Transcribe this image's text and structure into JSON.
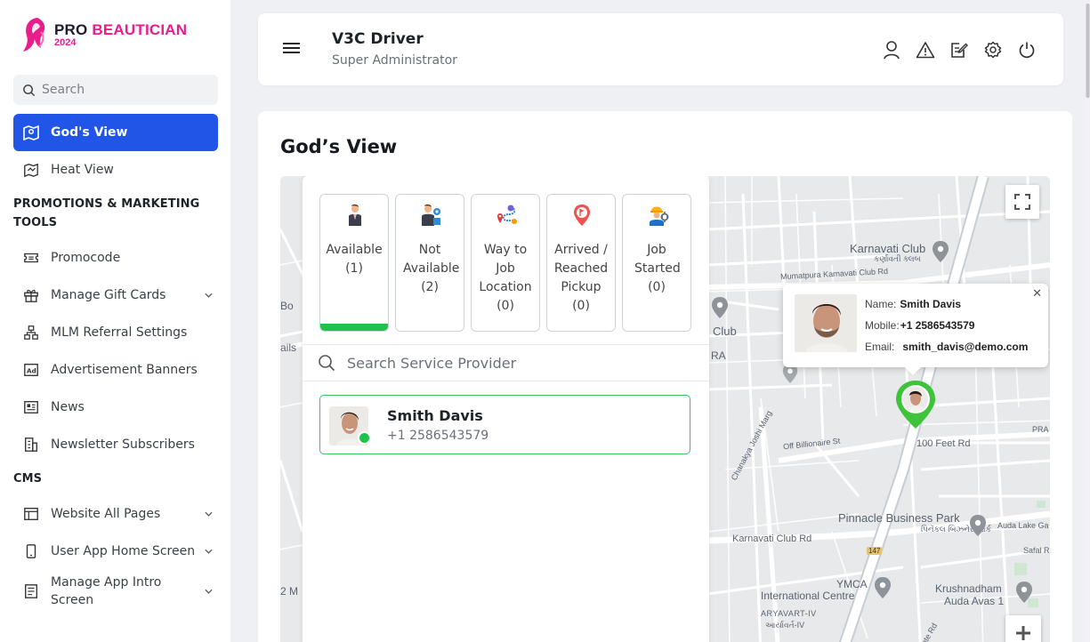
{
  "brand": {
    "name_part1": "PRO",
    "name_part2": "BEAUTICIAN",
    "year": "2024",
    "accent": "#e91e8c"
  },
  "sidebar": {
    "search_placeholder": "Search",
    "items": [
      {
        "label": "God's View",
        "icon": "map-icon",
        "active": true
      },
      {
        "label": "Heat View",
        "icon": "heat-map-icon"
      }
    ],
    "sections": [
      {
        "title": "PROMOTIONS & MARKETING TOOLS",
        "items": [
          {
            "label": "Promocode",
            "icon": "ticket-icon"
          },
          {
            "label": "Manage Gift Cards",
            "icon": "gift-icon",
            "has_submenu": true
          },
          {
            "label": "MLM Referral Settings",
            "icon": "hierarchy-icon"
          },
          {
            "label": "Advertisement Banners",
            "icon": "ad-icon"
          },
          {
            "label": "News",
            "icon": "newspaper-icon"
          },
          {
            "label": "Newsletter Subscribers",
            "icon": "building-icon"
          }
        ]
      },
      {
        "title": "CMS",
        "items": [
          {
            "label": "Website All Pages",
            "icon": "browser-icon",
            "has_submenu": true
          },
          {
            "label": "User App Home Screen",
            "icon": "mobile-icon",
            "has_submenu": true
          },
          {
            "label": "Manage App Intro Screen",
            "icon": "document-icon",
            "has_submenu": true
          }
        ]
      }
    ]
  },
  "header": {
    "title": "V3C Driver",
    "subtitle": "Super Administrator",
    "icons": [
      "user-icon",
      "warning-icon",
      "edit-icon",
      "settings-icon",
      "power-icon"
    ]
  },
  "main": {
    "title": "God’s View",
    "statuses": [
      {
        "label": "Available",
        "count": "(1)",
        "active": true
      },
      {
        "label": "Not Available",
        "count": "(2)"
      },
      {
        "label": "Way to Job Location",
        "count": "(0)"
      },
      {
        "label": "Arrived / Reached Pickup",
        "count": "(0)"
      },
      {
        "label": "Job Started",
        "count": "(0)"
      }
    ],
    "search_placeholder": "Search Service Provider",
    "providers": [
      {
        "name": "Smith Davis",
        "phone": "+1 2586543579",
        "online": true
      }
    ],
    "popup": {
      "name_label": "Name:",
      "name": "Smith Davis",
      "mobile_label": "Mobile:",
      "mobile": "+1 2586543579",
      "email_label": "Email:",
      "email": "smith_davis@demo.com"
    },
    "map_labels": {
      "karnavati_club": "Karnavati Club",
      "karnavati_club_local": "કર્ણાવતી ક્લબ",
      "mumatpura_rd": "Mumatpura Karnavati Club Rd",
      "bo": "Bo",
      "club": "Club",
      "ra": "RA",
      "ails": "ails",
      "chanakya_marg": "Chanakya Joshi Marg",
      "off_billionaire": "Off Billionaire St",
      "feet_rd": "100 Feet Rd",
      "pinnacle": "Pinnacle Business Park",
      "pinnacle_local": "પિનૅકલ બિઝનેસ પાર્ક",
      "auda_lake": "Auda Lake Ga",
      "safal": "Safal R",
      "karnavati_club_rd": "Karnavati Club Rd",
      "road_147": "147",
      "ymca": "YMCA",
      "intl_centre": "International Centre",
      "krushnadham": "Krushnadham",
      "auda_avas": "Auda Avas 1",
      "aryavart": "ARYAVART-IV",
      "aryavart_local": "આર્યાવર્ત-IV",
      "two_m": "2 M",
      "ate_rd": "ate Rd",
      "pra": "PRA"
    }
  },
  "colors": {
    "primary": "#2155e8",
    "success": "#21c24a"
  }
}
